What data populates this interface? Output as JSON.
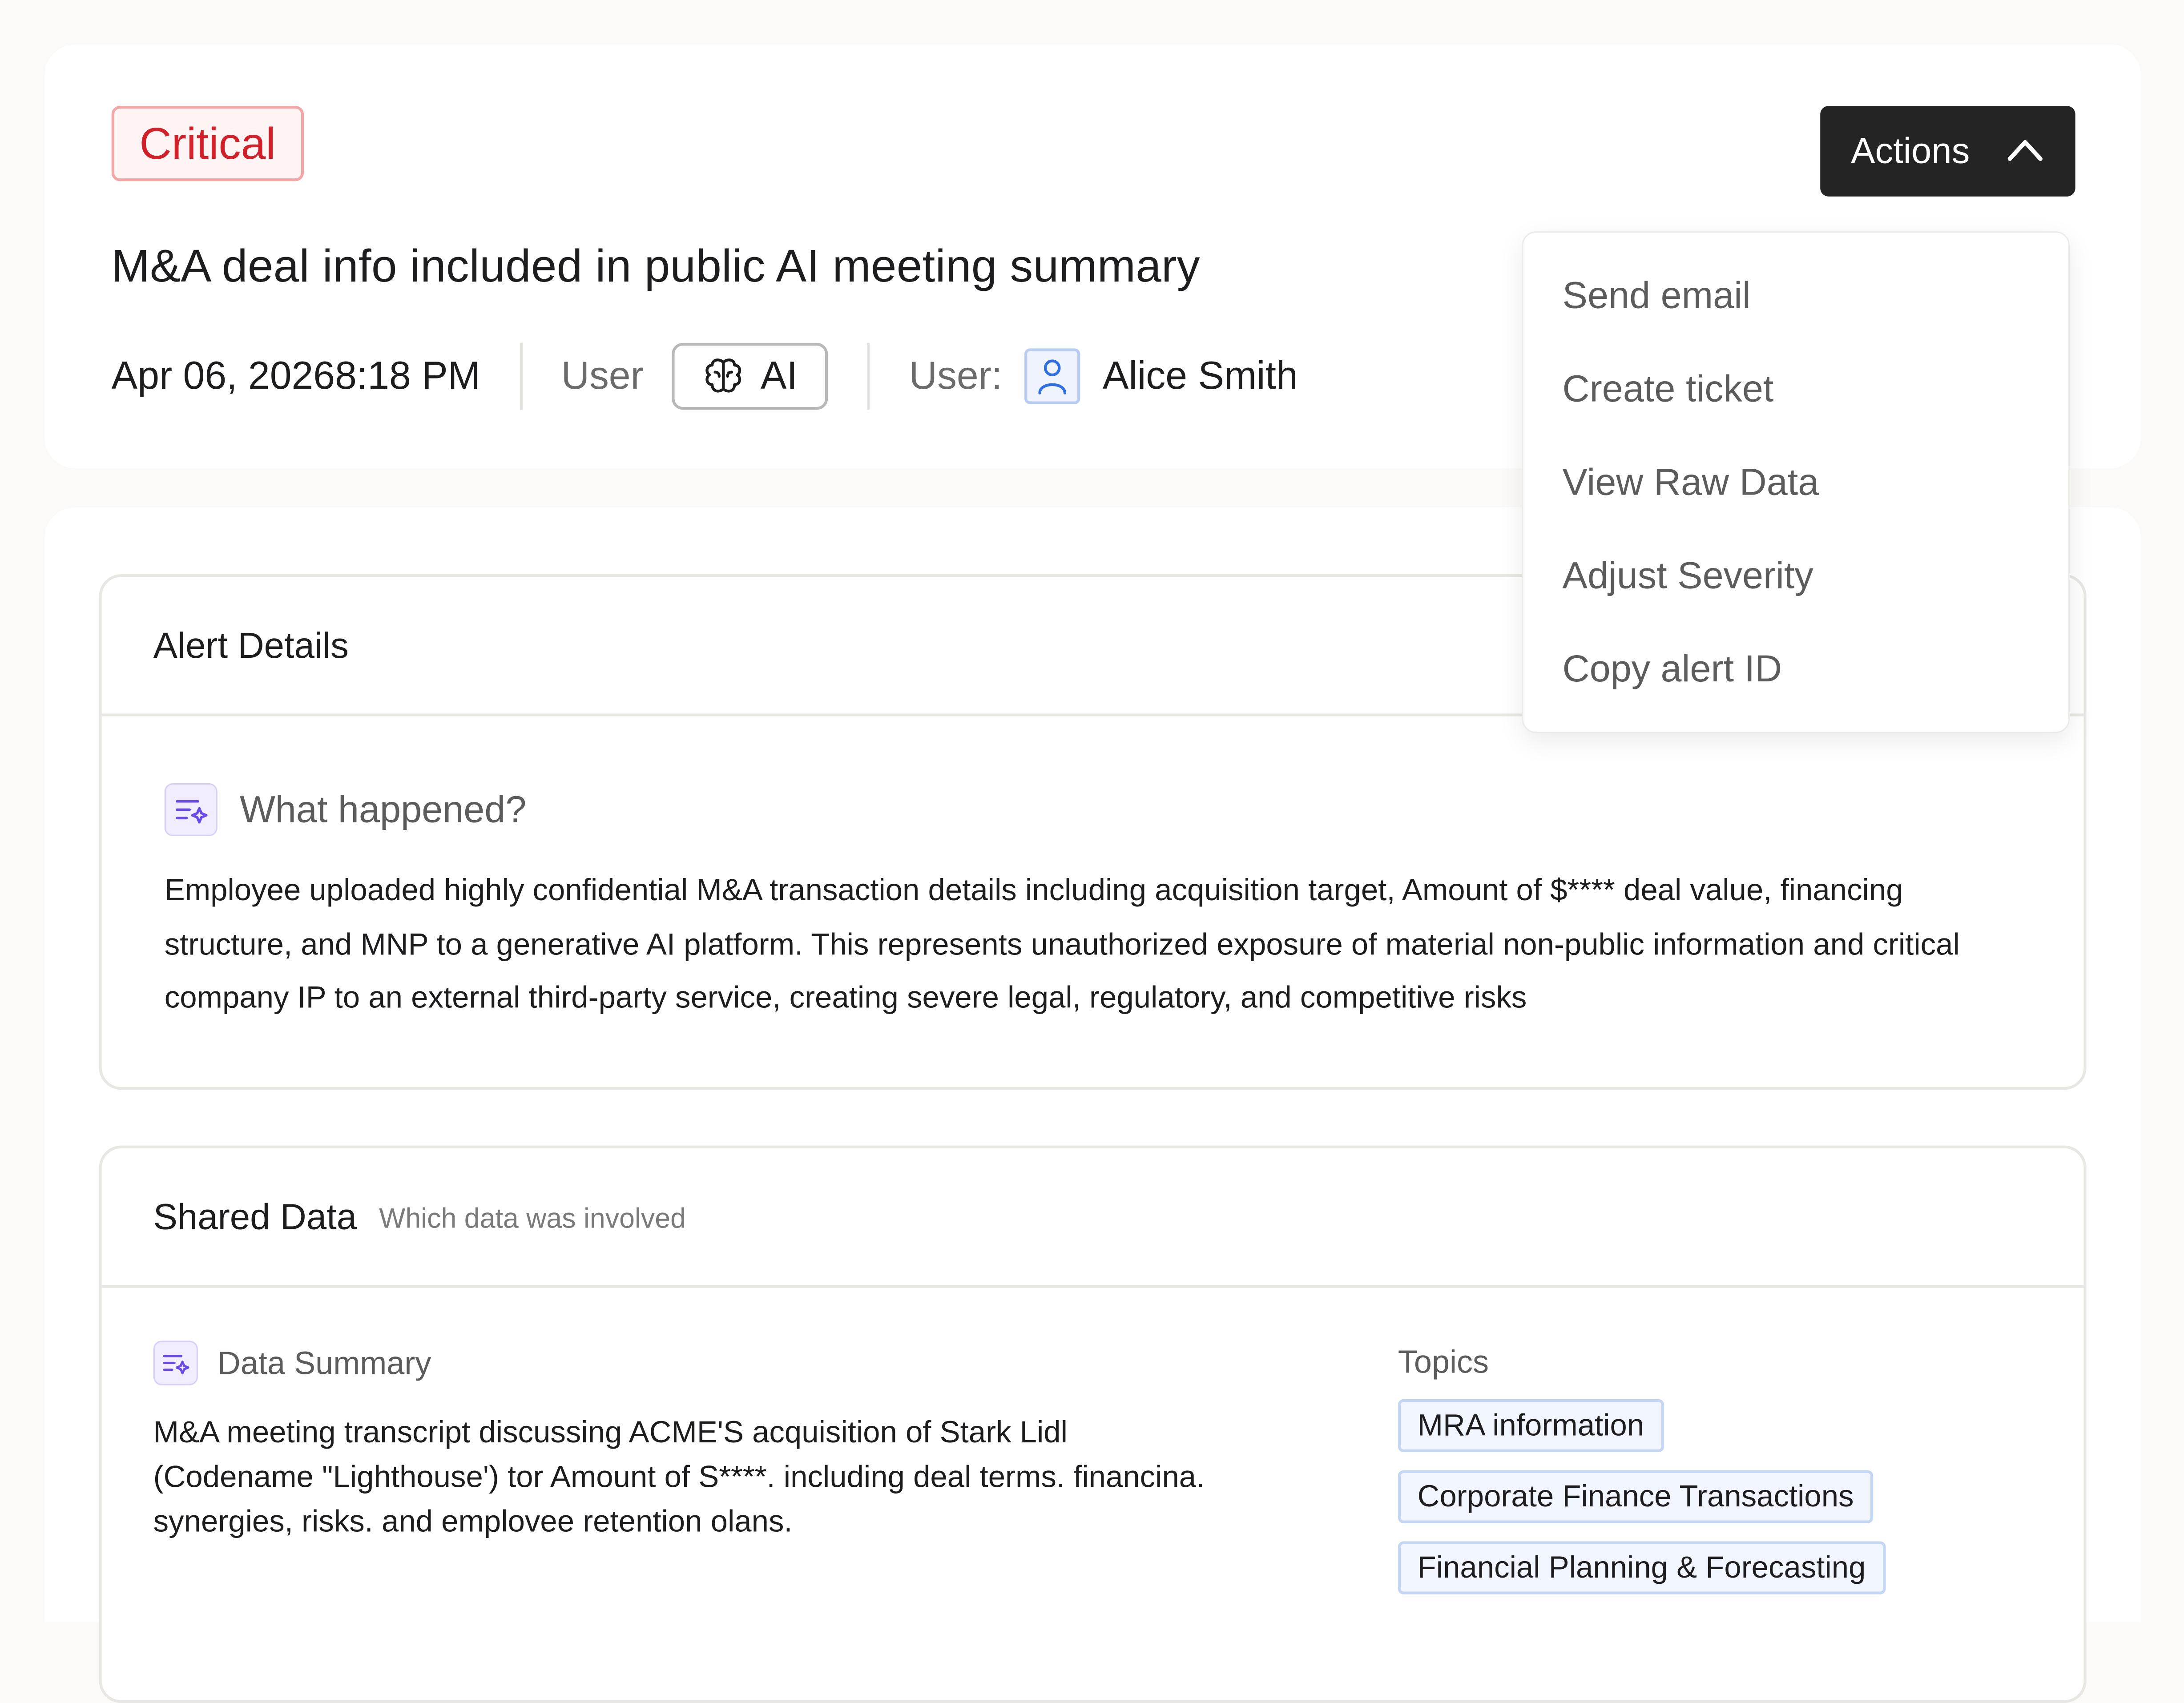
{
  "header": {
    "severity": "Critical",
    "actions_label": "Actions",
    "title": "M&A deal info included in public AI meeting summary",
    "datetime": "Apr 06, 20268:18 PM",
    "source_label": "User",
    "ai_chip_label": "AI",
    "user_label": "User:",
    "user_name": "Alice Smith"
  },
  "actions_menu": {
    "items": [
      "Send email",
      "Create ticket",
      "View Raw Data",
      "Adjust Severity",
      "Copy alert ID"
    ]
  },
  "alert_details": {
    "title": "Alert Details",
    "what_happened_label": "What happened?",
    "what_happened_text": "Employee uploaded highly confidential M&A transaction details including acquisition target, Amount of $**** deal value, financing structure, and MNP to a generative AI platform. This represents unauthorized exposure of material non-public information and critical company IP to an external third-party service, creating severe legal, regulatory, and competitive risks"
  },
  "shared_data": {
    "title": "Shared Data",
    "subtitle": "Which data was involved",
    "summary_label": "Data Summary",
    "summary_text": "M&A meeting transcript discussing ACME'S acquisition of Stark Lidl (Codename \"Lighthouse') tor Amount of S****. including deal terms. financina. synergies, risks. and emplovee retention olans.",
    "topics_label": "Topics",
    "topics": [
      "MRA information",
      "Corporate Finance Transactions",
      "Financial Planning & Forecasting"
    ]
  },
  "colors": {
    "critical": "#d0202a",
    "actions_bg": "#242424",
    "accent_purple": "#6b4be8",
    "accent_blue": "#2f6fe0"
  }
}
